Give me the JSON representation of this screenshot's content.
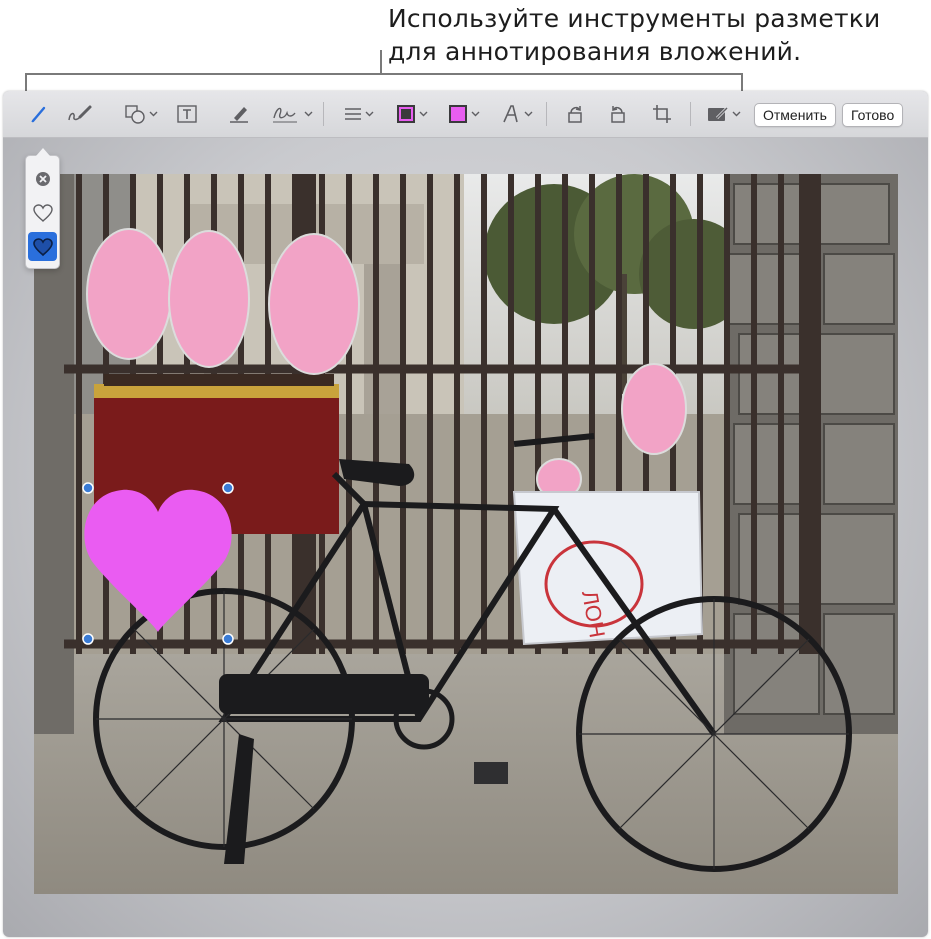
{
  "callout": {
    "line1": "Используйте инструменты разметки",
    "line2": "для аннотирования вложений."
  },
  "toolbar": {
    "tools": [
      {
        "icon": "pen-sketch-icon"
      },
      {
        "icon": "draw-icon"
      },
      {
        "icon": "shapes-icon"
      },
      {
        "icon": "text-icon"
      },
      {
        "icon": "highlight-icon"
      },
      {
        "icon": "sign-icon"
      },
      {
        "icon": "line-style-icon"
      },
      {
        "icon": "border-color-icon"
      },
      {
        "icon": "fill-color-icon"
      },
      {
        "icon": "text-style-icon"
      },
      {
        "icon": "rotate-right-icon"
      },
      {
        "icon": "rotate-left-icon"
      },
      {
        "icon": "crop-icon"
      },
      {
        "icon": "form-fill-icon"
      }
    ],
    "cancel_label": "Отменить",
    "done_label": "Готово",
    "border_color": "#e85ef0",
    "fill_color": "#e85ef0",
    "accent_color": "#2a6fdc"
  },
  "shapes_popup": {
    "items": [
      {
        "icon": "close-circle-icon"
      },
      {
        "icon": "heart-outline-icon"
      },
      {
        "icon": "heart-filled-icon",
        "selected": true
      }
    ]
  },
  "annotation": {
    "shape": "heart",
    "color": "#ea5cf2",
    "handle_color": "#3a7bd5"
  }
}
